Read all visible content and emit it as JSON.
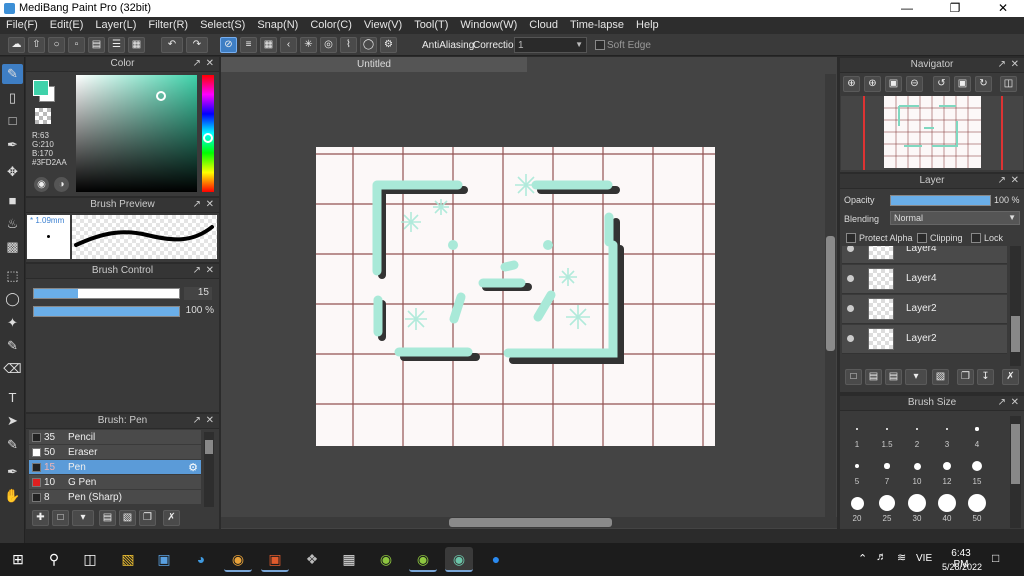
{
  "window": {
    "title": "MediBang Paint Pro (32bit)"
  },
  "menu": [
    "File(F)",
    "Edit(E)",
    "Layer(L)",
    "Filter(R)",
    "Select(S)",
    "Snap(N)",
    "Color(C)",
    "View(V)",
    "Tool(T)",
    "Window(W)",
    "Cloud",
    "Time-lapse",
    "Help"
  ],
  "toolbar": {
    "antialiasing_label": "AntiAliasing",
    "correction_label": "Correction",
    "correction_value": "1",
    "soft_edge_label": "Soft Edge"
  },
  "color_panel": {
    "title": "Color",
    "r": "R:63",
    "g": "G:210",
    "b": "B:170",
    "hex": "#3FD2AA",
    "accent": "#3FD2AA"
  },
  "brush_preview": {
    "title": "Brush Preview",
    "size": "* 1.09mm"
  },
  "brush_control": {
    "title": "Brush Control",
    "size_value": "15",
    "opacity_value": "100 %",
    "size_fraction": 0.3,
    "opacity_fraction": 1.0
  },
  "brush_panel": {
    "title": "Brush: Pen",
    "items": [
      {
        "size": "35",
        "name": "Pencil",
        "color": "#222222",
        "active": false
      },
      {
        "size": "50",
        "name": "Eraser",
        "color": "#ffffff",
        "active": false
      },
      {
        "size": "15",
        "name": "Pen",
        "color": "#222222",
        "active": true
      },
      {
        "size": "10",
        "name": "G Pen",
        "color": "#e02020",
        "active": false
      },
      {
        "size": "8",
        "name": "Pen (Sharp)",
        "color": "#222222",
        "active": false
      }
    ]
  },
  "document": {
    "tab": "Untitled"
  },
  "navigator": {
    "title": "Navigator"
  },
  "layer_panel": {
    "title": "Layer",
    "opacity_label": "Opacity",
    "opacity_value": "100 %",
    "blending_label": "Blending",
    "blending_value": "Normal",
    "protect_alpha": "Protect Alpha",
    "clipping": "Clipping",
    "lock": "Lock",
    "layers": [
      "Layer4",
      "Layer4",
      "Layer2",
      "Layer2"
    ]
  },
  "brush_size": {
    "title": "Brush Size",
    "sizes": [
      "1",
      "1.5",
      "2",
      "3",
      "4",
      "5",
      "7",
      "10",
      "12",
      "15",
      "20",
      "25",
      "30",
      "40",
      "50"
    ]
  },
  "taskbar": {
    "time": "6:43 PM",
    "date": "5/28/2022",
    "lang": "VIE"
  }
}
